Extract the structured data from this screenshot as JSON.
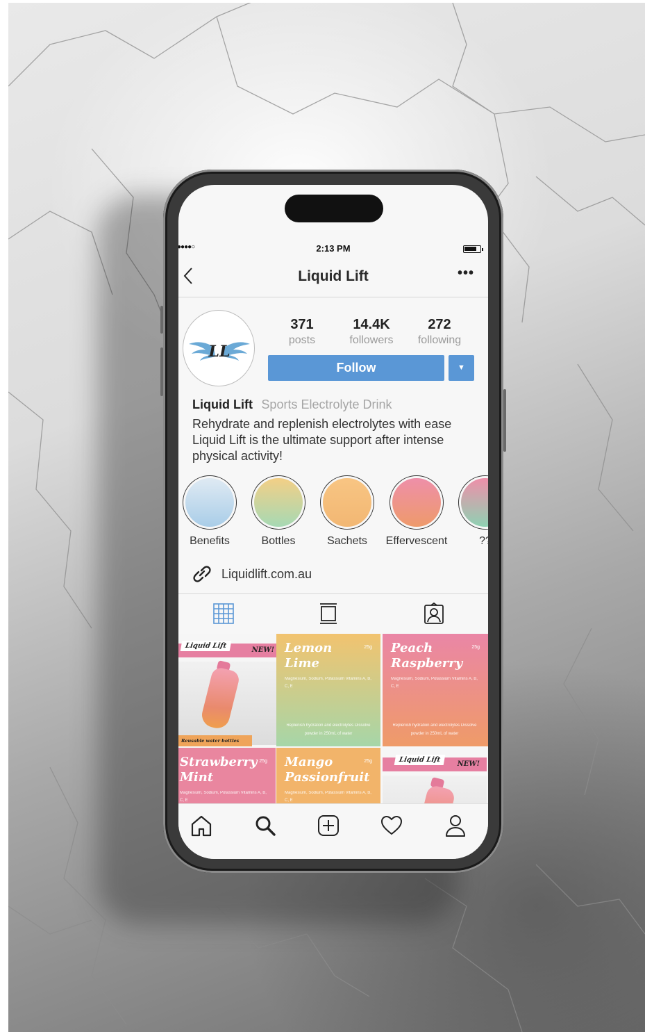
{
  "status_bar": {
    "signal": "●●●●○",
    "time": "2:13 PM"
  },
  "header": {
    "back_icon": "chevron-left-icon",
    "title": "Liquid Lift",
    "more_icon": "more-dots-icon"
  },
  "profile": {
    "avatar_logo_text": "LL",
    "stats": [
      {
        "value": "371",
        "label": "posts"
      },
      {
        "value": "14.4K",
        "label": "followers"
      },
      {
        "value": "272",
        "label": "following"
      }
    ],
    "follow_label": "Follow",
    "dropdown_icon": "▼"
  },
  "bio": {
    "name": "Liquid Lift",
    "category": "Sports Electrolyte Drink",
    "line1": "Rehydrate and replenish electrolytes with ease",
    "line2": "Liquid Lift is the ultimate support after intense physical activity!"
  },
  "highlights": [
    {
      "label": "Benefits",
      "colors": [
        "#d9e8f4",
        "#a9cde8"
      ]
    },
    {
      "label": "Bottles",
      "colors": [
        "#f3cf86",
        "#a6d9b4"
      ]
    },
    {
      "label": "Sachets",
      "colors": [
        "#f8c583",
        "#f2b773"
      ]
    },
    {
      "label": "Effervescent",
      "colors": [
        "#ee8fa9",
        "#ee9a6b"
      ]
    },
    {
      "label": "??",
      "colors": [
        "#ee8fa9",
        "#8fd1b3"
      ]
    }
  ],
  "website": {
    "icon": "link-icon",
    "text": "Liquidlift.com.au"
  },
  "tabs": [
    {
      "name": "grid",
      "icon": "grid-icon",
      "active": true
    },
    {
      "name": "feed",
      "icon": "feed-icon",
      "active": false
    },
    {
      "name": "tagged",
      "icon": "tagged-icon",
      "active": false
    }
  ],
  "posts": [
    {
      "kind": "promo",
      "brand": "Liquid Lift",
      "badge": "NEW!",
      "tag": "Reusable water bottles"
    },
    {
      "kind": "flavour",
      "name": "Lemon Lime",
      "grams": "25g",
      "ingredients": "Magnesium, Sodium, Potassium Vitamins A, B, C, E",
      "footer": "Replenish hydration and electrolytes Dissolve powder in 250mL of water",
      "colors": [
        "#f2c36f",
        "#a6d6a8"
      ]
    },
    {
      "kind": "flavour",
      "name": "Peach Raspberry",
      "grams": "25g",
      "ingredients": "Magnesium, Sodium, Potassium Vitamins A, B, C, E",
      "footer": "Replenish hydration and electrolytes Dissolve powder in 250mL of water",
      "colors": [
        "#ea86a6",
        "#ef9b68"
      ]
    },
    {
      "kind": "flavour",
      "name": "Strawberry Mint",
      "grams": "25g",
      "ingredients": "Magnesium, Sodium, Potassium Vitamins A, B, C, E",
      "footer": "",
      "colors": [
        "#e9869f",
        "#e9869f"
      ]
    },
    {
      "kind": "flavour",
      "name": "Mango Passionfruit",
      "grams": "25g",
      "ingredients": "Magnesium, Sodium, Potassium Vitamins A, B, C, E",
      "footer": "",
      "colors": [
        "#f2b46a",
        "#f2b46a"
      ]
    },
    {
      "kind": "promo",
      "brand": "Liquid Lift",
      "badge": "NEW!",
      "tag": ""
    }
  ],
  "bottom_nav": [
    {
      "name": "home",
      "icon": "home-icon"
    },
    {
      "name": "search",
      "icon": "search-icon"
    },
    {
      "name": "create",
      "icon": "plus-square-icon"
    },
    {
      "name": "activity",
      "icon": "heart-icon"
    },
    {
      "name": "profile",
      "icon": "profile-icon"
    }
  ],
  "accent_color": "#5a97d6"
}
